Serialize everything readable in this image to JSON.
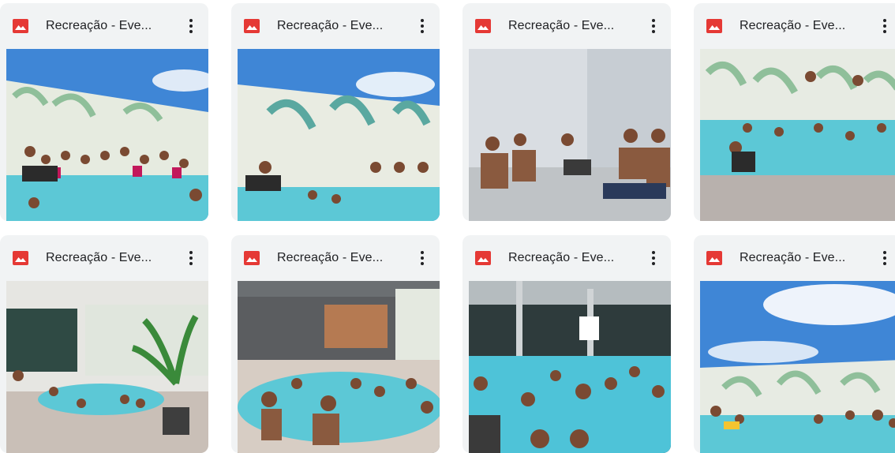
{
  "files": [
    {
      "name": "Recreação - Eve...",
      "icon": "image-file-icon",
      "menu": "more-vert-icon"
    },
    {
      "name": "Recreação - Eve...",
      "icon": "image-file-icon",
      "menu": "more-vert-icon"
    },
    {
      "name": "Recreação - Eve...",
      "icon": "image-file-icon",
      "menu": "more-vert-icon"
    },
    {
      "name": "Recreação - Eve...",
      "icon": "image-file-icon",
      "menu": "more-vert-icon"
    },
    {
      "name": "Recreação - Eve...",
      "icon": "image-file-icon",
      "menu": "more-vert-icon"
    },
    {
      "name": "Recreação - Eve...",
      "icon": "image-file-icon",
      "menu": "more-vert-icon"
    },
    {
      "name": "Recreação - Eve...",
      "icon": "image-file-icon",
      "menu": "more-vert-icon"
    },
    {
      "name": "Recreação - Eve...",
      "icon": "image-file-icon",
      "menu": "more-vert-icon"
    }
  ],
  "colors": {
    "card_bg": "#f1f3f4",
    "image_icon": "#e53935",
    "pool": "#5cc8d6",
    "sky": "#3f86d6"
  }
}
